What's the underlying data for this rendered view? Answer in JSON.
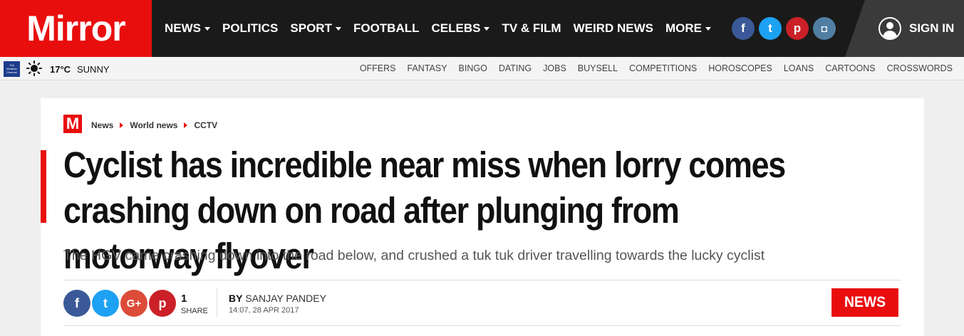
{
  "brand": {
    "logo_text": "Mirror",
    "accent": "#e90e0e"
  },
  "nav": {
    "items": [
      {
        "label": "NEWS",
        "has_dropdown": true
      },
      {
        "label": "POLITICS",
        "has_dropdown": false
      },
      {
        "label": "SPORT",
        "has_dropdown": true
      },
      {
        "label": "FOOTBALL",
        "has_dropdown": false
      },
      {
        "label": "CELEBS",
        "has_dropdown": true
      },
      {
        "label": "TV & FILM",
        "has_dropdown": false
      },
      {
        "label": "WEIRD NEWS",
        "has_dropdown": false
      },
      {
        "label": "MORE",
        "has_dropdown": true
      }
    ],
    "social": [
      {
        "icon": "facebook-icon",
        "glyph": "f",
        "color": "#3b5998"
      },
      {
        "icon": "twitter-icon",
        "glyph": "t",
        "color": "#1da1f2"
      },
      {
        "icon": "pinterest-icon",
        "glyph": "p",
        "color": "#cb2027"
      },
      {
        "icon": "instagram-icon",
        "glyph": "◘",
        "color": "#517fa4"
      }
    ],
    "signin_label": "SIGN IN"
  },
  "subbar": {
    "weather_logo": "The Weather Channel",
    "temperature": "17°C",
    "condition": "SUNNY",
    "links": [
      "OFFERS",
      "FANTASY",
      "BINGO",
      "DATING",
      "JOBS",
      "BUYSELL",
      "COMPETITIONS",
      "HOROSCOPES",
      "LOANS",
      "CARTOONS",
      "CROSSWORDS"
    ]
  },
  "article": {
    "m_logo": "M",
    "breadcrumb": [
      "News",
      "World news",
      "CCTV"
    ],
    "headline": "Cyclist has incredible near miss when lorry comes crashing down on road after plunging from motorway flyover",
    "standfirst": "The HGV came crashing down into the road below, and crushed a tuk tuk driver travelling towards the lucky cyclist",
    "share": {
      "buttons": [
        {
          "icon": "facebook-icon",
          "glyph": "f",
          "color": "#3b5998"
        },
        {
          "icon": "twitter-icon",
          "glyph": "t",
          "color": "#1da1f2"
        },
        {
          "icon": "google-plus-icon",
          "glyph": "G+",
          "color": "#dd4b39"
        },
        {
          "icon": "pinterest-icon",
          "glyph": "p",
          "color": "#cb2027"
        }
      ],
      "count": "1",
      "label": "SHARE"
    },
    "byline_prefix": "BY",
    "author": "SANJAY PANDEY",
    "timestamp": "14:07, 28 APR 2017",
    "section_badge": "NEWS"
  }
}
